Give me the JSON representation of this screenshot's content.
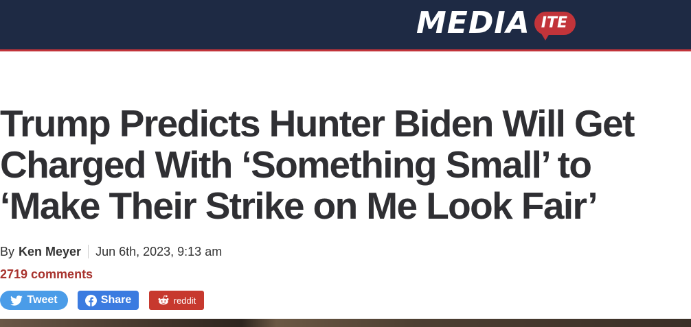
{
  "site": {
    "logo_text": "MEDIA",
    "logo_bubble": "ITE",
    "brand_color": "#c2343a",
    "header_bg": "#1e2a44"
  },
  "article": {
    "headline_lines": [
      "Trump Predicts Hunter Biden Will Get",
      "Charged With ‘Something Small’ to",
      "‘Make Their Strike on Me Look Fair’"
    ],
    "byline_prefix": "By",
    "author": "Ken Meyer",
    "date": "Jun 6th, 2023, 9:13 am",
    "comments": "2719 comments"
  },
  "share": {
    "tweet_label": "Tweet",
    "share_label": "Share",
    "reddit_label": "reddit",
    "tweet_icon": "twitter-bird-icon",
    "share_icon": "facebook-icon",
    "reddit_icon": "reddit-alien-icon"
  }
}
